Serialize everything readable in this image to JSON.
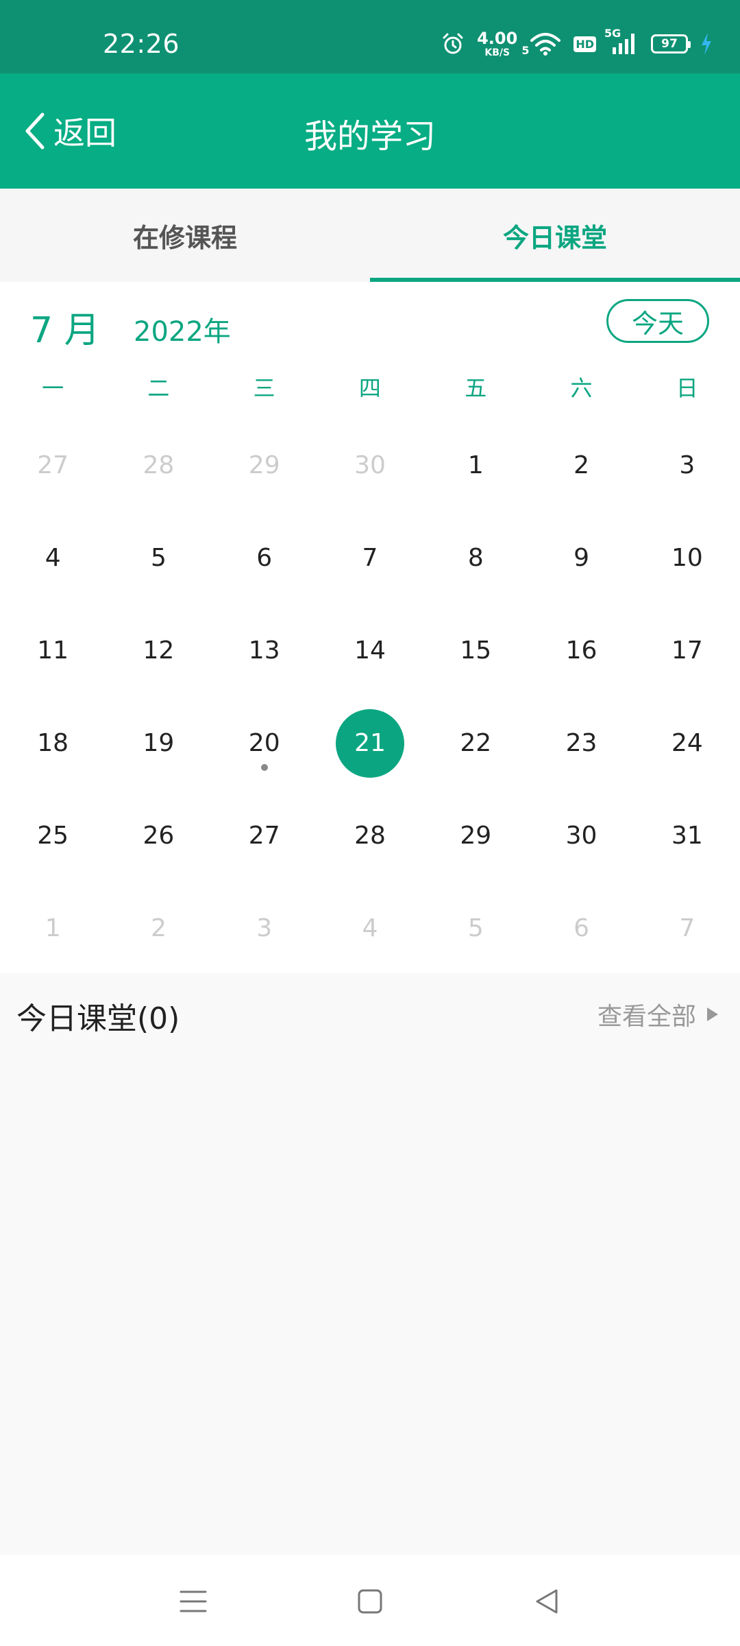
{
  "status_bar": {
    "time": "22:26",
    "net_speed_value": "4.00",
    "net_speed_unit": "KB/S",
    "wifi_label": "5",
    "hd_label": "HD",
    "network_label": "5G",
    "battery_level": "97",
    "icons": [
      "alarm-icon",
      "wifi-icon",
      "signal-icon",
      "battery-icon",
      "charging-icon"
    ]
  },
  "header": {
    "back_label": "返回",
    "title": "我的学习"
  },
  "tabs": [
    {
      "label": "在修课程",
      "active": false
    },
    {
      "label": "今日课堂",
      "active": true
    }
  ],
  "calendar": {
    "month": "7 月",
    "year": "2022年",
    "today_button": "今天",
    "weekdays": [
      "一",
      "二",
      "三",
      "四",
      "五",
      "六",
      "日"
    ],
    "days": [
      {
        "n": "27",
        "other": true
      },
      {
        "n": "28",
        "other": true
      },
      {
        "n": "29",
        "other": true
      },
      {
        "n": "30",
        "other": true
      },
      {
        "n": "1"
      },
      {
        "n": "2"
      },
      {
        "n": "3"
      },
      {
        "n": "4"
      },
      {
        "n": "5"
      },
      {
        "n": "6"
      },
      {
        "n": "7"
      },
      {
        "n": "8"
      },
      {
        "n": "9"
      },
      {
        "n": "10"
      },
      {
        "n": "11"
      },
      {
        "n": "12"
      },
      {
        "n": "13"
      },
      {
        "n": "14"
      },
      {
        "n": "15"
      },
      {
        "n": "16"
      },
      {
        "n": "17"
      },
      {
        "n": "18"
      },
      {
        "n": "19"
      },
      {
        "n": "20",
        "dot": true
      },
      {
        "n": "21",
        "selected": true
      },
      {
        "n": "22"
      },
      {
        "n": "23"
      },
      {
        "n": "24"
      },
      {
        "n": "25"
      },
      {
        "n": "26"
      },
      {
        "n": "27"
      },
      {
        "n": "28"
      },
      {
        "n": "29"
      },
      {
        "n": "30"
      },
      {
        "n": "31"
      },
      {
        "n": "1",
        "other": true
      },
      {
        "n": "2",
        "other": true
      },
      {
        "n": "3",
        "other": true
      },
      {
        "n": "4",
        "other": true
      },
      {
        "n": "5",
        "other": true
      },
      {
        "n": "6",
        "other": true
      },
      {
        "n": "7",
        "other": true
      }
    ]
  },
  "today_section": {
    "title": "今日课堂(0)",
    "view_all": "查看全部"
  },
  "colors": {
    "status_bar": "#0e9172",
    "header": "#07ad84",
    "accent": "#0ba681"
  }
}
